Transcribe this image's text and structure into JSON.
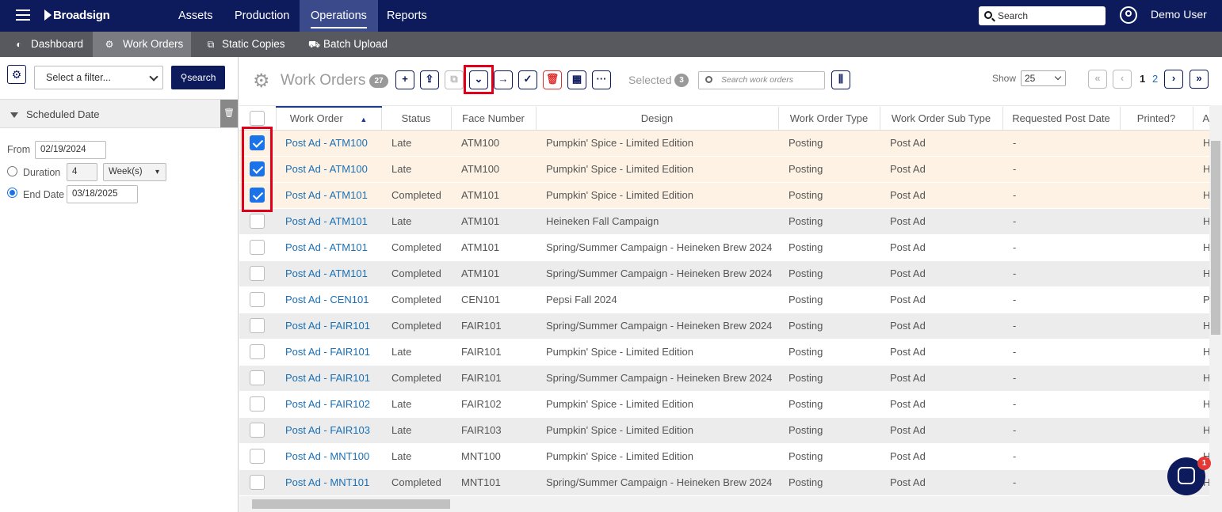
{
  "topnav": {
    "brand": "Broadsign",
    "items": [
      "Assets",
      "Production",
      "Operations",
      "Reports"
    ],
    "active": "Operations",
    "search_placeholder": "Search",
    "user": "Demo User"
  },
  "subnav": {
    "items": [
      "Dashboard",
      "Work Orders",
      "Static Copies",
      "Batch Upload"
    ],
    "active": "Work Orders"
  },
  "filter": {
    "select_placeholder": "Select a filter...",
    "search_label": "search",
    "section_title": "Scheduled Date",
    "from_label": "From",
    "from_value": "02/19/2024",
    "duration_label": "Duration",
    "duration_value": "4",
    "duration_unit": "Week(s)",
    "end_label": "End Date",
    "end_value": "03/18/2025",
    "selected_mode": "End Date"
  },
  "toolbar": {
    "title": "Work Orders",
    "count": "27",
    "selected_label": "Selected",
    "selected_count": "3",
    "search_placeholder": "Search work orders",
    "show_label": "Show",
    "show_value": "25",
    "pages": [
      "1",
      "2"
    ],
    "current_page": "1"
  },
  "table": {
    "columns": [
      "Work Order",
      "Status",
      "Face Number",
      "Design",
      "Work Order Type",
      "Work Order Sub Type",
      "Requested Post Date",
      "Printed?",
      "Ad"
    ],
    "sorted_column": "Work Order",
    "rows": [
      {
        "checked": true,
        "work_order": "Post Ad - ATM100",
        "status": "Late",
        "face": "ATM100",
        "design": "Pumpkin' Spice - Limited Edition",
        "type": "Posting",
        "subtype": "Post Ad",
        "requested": "-",
        "printed": "",
        "ad": "Hei"
      },
      {
        "checked": true,
        "work_order": "Post Ad - ATM100",
        "status": "Late",
        "face": "ATM100",
        "design": "Pumpkin' Spice - Limited Edition",
        "type": "Posting",
        "subtype": "Post Ad",
        "requested": "-",
        "printed": "",
        "ad": "Hei"
      },
      {
        "checked": true,
        "work_order": "Post Ad - ATM101",
        "status": "Completed",
        "face": "ATM101",
        "design": "Pumpkin' Spice - Limited Edition",
        "type": "Posting",
        "subtype": "Post Ad",
        "requested": "-",
        "printed": "",
        "ad": "Hei"
      },
      {
        "checked": false,
        "work_order": "Post Ad - ATM101",
        "status": "Late",
        "face": "ATM101",
        "design": "Heineken Fall Campaign",
        "type": "Posting",
        "subtype": "Post Ad",
        "requested": "-",
        "printed": "",
        "ad": "Hei"
      },
      {
        "checked": false,
        "work_order": "Post Ad - ATM101",
        "status": "Completed",
        "face": "ATM101",
        "design": "Spring/Summer Campaign - Heineken Brew 2024",
        "type": "Posting",
        "subtype": "Post Ad",
        "requested": "-",
        "printed": "",
        "ad": "Hei"
      },
      {
        "checked": false,
        "work_order": "Post Ad - ATM101",
        "status": "Completed",
        "face": "ATM101",
        "design": "Spring/Summer Campaign - Heineken Brew 2024",
        "type": "Posting",
        "subtype": "Post Ad",
        "requested": "-",
        "printed": "",
        "ad": "Hei"
      },
      {
        "checked": false,
        "work_order": "Post Ad - CEN101",
        "status": "Completed",
        "face": "CEN101",
        "design": "Pepsi Fall 2024",
        "type": "Posting",
        "subtype": "Post Ad",
        "requested": "-",
        "printed": "",
        "ad": "Pep"
      },
      {
        "checked": false,
        "work_order": "Post Ad - FAIR101",
        "status": "Completed",
        "face": "FAIR101",
        "design": "Spring/Summer Campaign - Heineken Brew 2024",
        "type": "Posting",
        "subtype": "Post Ad",
        "requested": "-",
        "printed": "",
        "ad": "Hei"
      },
      {
        "checked": false,
        "work_order": "Post Ad - FAIR101",
        "status": "Late",
        "face": "FAIR101",
        "design": "Pumpkin' Spice - Limited Edition",
        "type": "Posting",
        "subtype": "Post Ad",
        "requested": "-",
        "printed": "",
        "ad": "Hei"
      },
      {
        "checked": false,
        "work_order": "Post Ad - FAIR101",
        "status": "Completed",
        "face": "FAIR101",
        "design": "Spring/Summer Campaign - Heineken Brew 2024",
        "type": "Posting",
        "subtype": "Post Ad",
        "requested": "-",
        "printed": "",
        "ad": "Hei"
      },
      {
        "checked": false,
        "work_order": "Post Ad - FAIR102",
        "status": "Late",
        "face": "FAIR102",
        "design": "Pumpkin' Spice - Limited Edition",
        "type": "Posting",
        "subtype": "Post Ad",
        "requested": "-",
        "printed": "",
        "ad": "Hei"
      },
      {
        "checked": false,
        "work_order": "Post Ad - FAIR103",
        "status": "Late",
        "face": "FAIR103",
        "design": "Pumpkin' Spice - Limited Edition",
        "type": "Posting",
        "subtype": "Post Ad",
        "requested": "-",
        "printed": "",
        "ad": "Hei"
      },
      {
        "checked": false,
        "work_order": "Post Ad - MNT100",
        "status": "Late",
        "face": "MNT100",
        "design": "Pumpkin' Spice - Limited Edition",
        "type": "Posting",
        "subtype": "Post Ad",
        "requested": "-",
        "printed": "",
        "ad": "Hei"
      },
      {
        "checked": false,
        "work_order": "Post Ad - MNT101",
        "status": "Completed",
        "face": "MNT101",
        "design": "Spring/Summer Campaign - Heineken Brew 2024",
        "type": "Posting",
        "subtype": "Post Ad",
        "requested": "-",
        "printed": "",
        "ad": "Hei"
      }
    ]
  },
  "chat": {
    "notifications": "1"
  },
  "colors": {
    "nav": "#0d1a5c",
    "subnav": "#58595f",
    "link": "#1a6fb5",
    "checkbox": "#1a73e8",
    "highlight": "#e0001a",
    "selected_row": "#fdf2e3"
  }
}
